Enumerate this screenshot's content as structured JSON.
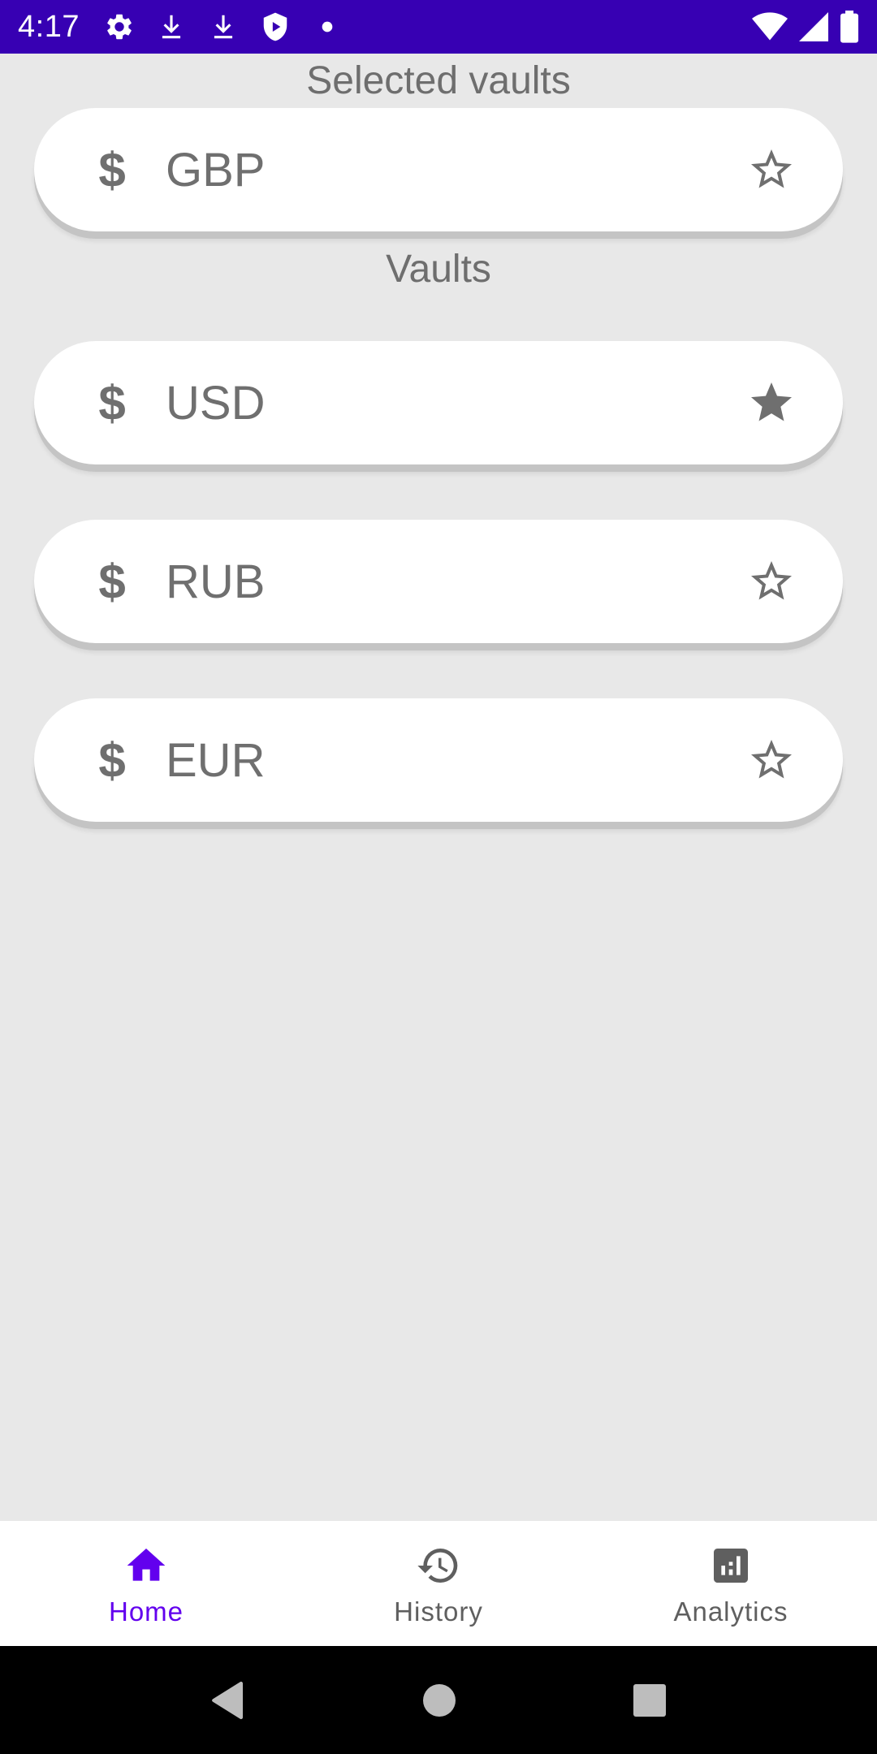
{
  "status_bar": {
    "time": "4:17",
    "background": "#3700b3",
    "left_icons": [
      "settings-icon",
      "download-icon",
      "download-icon",
      "shield-play-icon",
      "dot-icon"
    ],
    "right_icons": [
      "wifi-icon",
      "signal-icon",
      "battery-icon"
    ]
  },
  "home": {
    "selected_title": "Selected vaults",
    "vaults_title": "Vaults",
    "selected_vaults": [
      {
        "currency_symbol": "$",
        "code": "GBP",
        "starred": false
      }
    ],
    "vaults": [
      {
        "currency_symbol": "$",
        "code": "USD",
        "starred": true
      },
      {
        "currency_symbol": "$",
        "code": "RUB",
        "starred": false
      },
      {
        "currency_symbol": "$",
        "code": "EUR",
        "starred": false
      }
    ]
  },
  "bottom_nav": {
    "active_color": "#6200ee",
    "inactive_color": "#5f5f5f",
    "items": [
      {
        "label": "Home",
        "icon": "home-icon",
        "active": true
      },
      {
        "label": "History",
        "icon": "history-icon",
        "active": false
      },
      {
        "label": "Analytics",
        "icon": "analytics-icon",
        "active": false
      }
    ]
  },
  "system_nav": {
    "buttons": [
      "back-icon",
      "home-circle-icon",
      "recents-icon"
    ]
  }
}
